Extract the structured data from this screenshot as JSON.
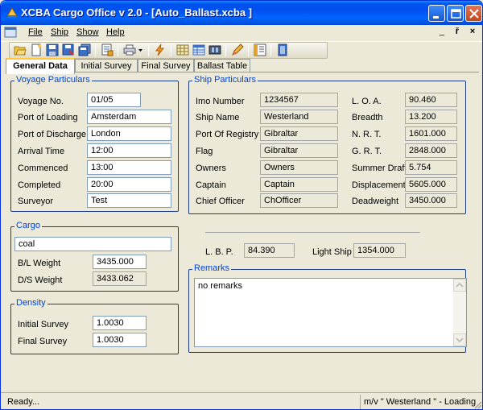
{
  "window": {
    "title": "XCBA Cargo Office v 2.0 - [Auto_Ballast.xcba ]"
  },
  "menu": {
    "items": [
      "File",
      "Ship",
      "Show",
      "Help"
    ],
    "mdi_minimize": "_",
    "mdi_restore": "ř",
    "mdi_close": "×"
  },
  "tabs": [
    "General Data",
    "Initial Survey",
    "Final Survey",
    "Ballast Table"
  ],
  "voyage": {
    "title": "Voyage Particulars",
    "fields": [
      {
        "label": "Voyage No.",
        "value": "01/05"
      },
      {
        "label": "Port of Loading",
        "value": "Amsterdam"
      },
      {
        "label": "Port of Discharge",
        "value": "London"
      },
      {
        "label": "Arrival Time",
        "value": "12:00"
      },
      {
        "label": "Commenced",
        "value": "13:00"
      },
      {
        "label": "Completed",
        "value": "20:00"
      },
      {
        "label": "Surveyor",
        "value": "Test"
      }
    ]
  },
  "ship": {
    "title": "Ship Particulars",
    "left": [
      {
        "label": "Imo Number",
        "value": "1234567"
      },
      {
        "label": "Ship Name",
        "value": "Westerland"
      },
      {
        "label": "Port Of Registry",
        "value": "Gibraltar"
      },
      {
        "label": "Flag",
        "value": "Gibraltar"
      },
      {
        "label": "Owners",
        "value": "Owners"
      },
      {
        "label": "Captain",
        "value": "Captain"
      },
      {
        "label": "Chief Officer",
        "value": "ChOfficer"
      }
    ],
    "right": [
      {
        "label": "L. O. A.",
        "value": "90.460"
      },
      {
        "label": "Breadth",
        "value": "13.200"
      },
      {
        "label": "N. R. T.",
        "value": "1601.000"
      },
      {
        "label": "G. R. T.",
        "value": "2848.000"
      },
      {
        "label": "Summer Draft",
        "value": "5.754"
      },
      {
        "label": "Displacement",
        "value": "5605.000"
      },
      {
        "label": "Deadweight",
        "value": "3450.000"
      }
    ]
  },
  "cargo": {
    "title": "Cargo",
    "name": "coal",
    "bl_label": "B/L Weight",
    "bl_value": "3435.000",
    "ds_label": "D/S Weight",
    "ds_value": "3433.062"
  },
  "density": {
    "title": "Density",
    "initial_label": "Initial Survey",
    "initial_value": "1.0030",
    "final_label": "Final Survey",
    "final_value": "1.0030"
  },
  "lbp": {
    "label": "L. B. P.",
    "value": "84.390"
  },
  "light_ship": {
    "label": "Light Ship",
    "value": "1354.000"
  },
  "remarks": {
    "title": "Remarks",
    "text": "no remarks"
  },
  "status": {
    "left": "Ready...",
    "right": "m/v  \" Westerland \" - Loading"
  },
  "colors": {
    "title_bar": "#0054E3",
    "group_title": "#0046D5",
    "tab_highlight": "#FFC83C"
  }
}
